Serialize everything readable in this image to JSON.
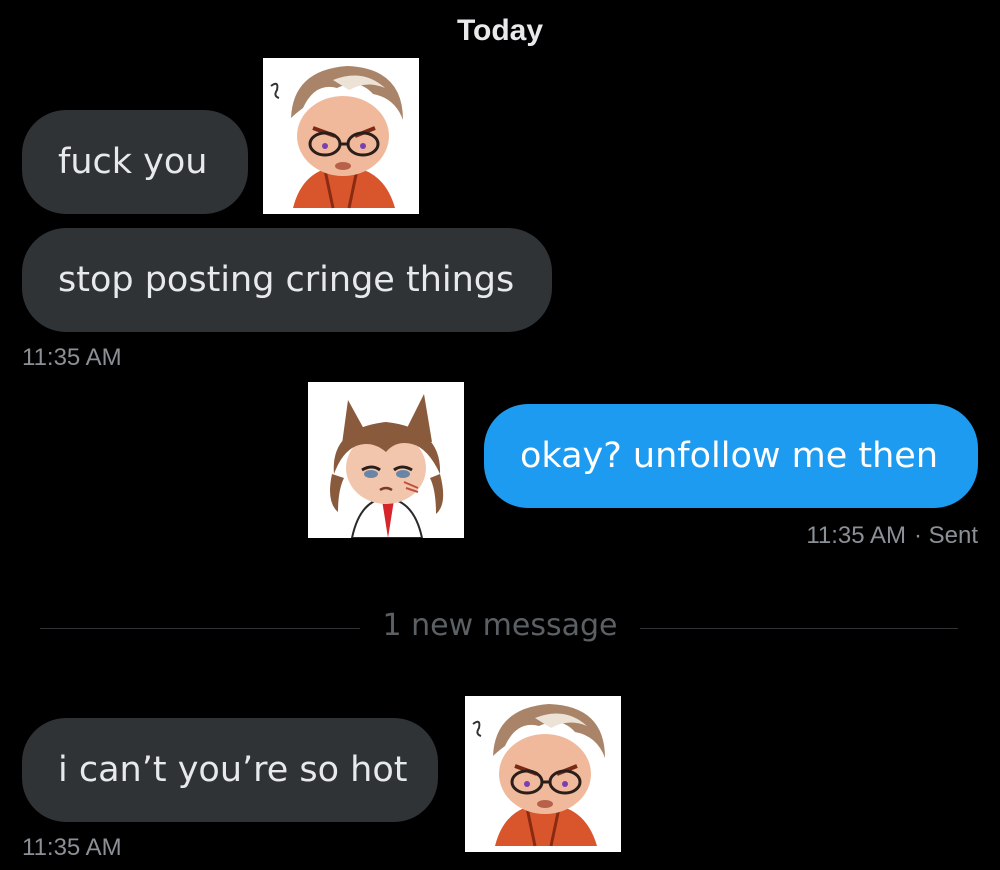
{
  "conversation": {
    "date_header": "Today",
    "messages": [
      {
        "direction": "incoming",
        "text": "fuck you"
      },
      {
        "direction": "incoming",
        "text": "stop posting cringe things",
        "timestamp": "11:35 AM"
      },
      {
        "direction": "outgoing",
        "text": "okay? unfollow me then",
        "timestamp": "11:35 AM",
        "status": "· Sent"
      },
      {
        "direction": "incoming",
        "text": "i can’t you’re so hot",
        "timestamp": "11:35 AM"
      }
    ],
    "new_message_divider": "1 new message"
  },
  "stickers": [
    {
      "icon": "angry-character-sticker-icon"
    },
    {
      "icon": "annoyed-character-sticker-icon"
    },
    {
      "icon": "angry-character-sticker-icon"
    }
  ],
  "colors": {
    "background": "#000000",
    "incoming_bubble": "#2f3336",
    "outgoing_bubble": "#1d9bf0",
    "text": "#e7e9ea",
    "muted": "#8b9096"
  }
}
